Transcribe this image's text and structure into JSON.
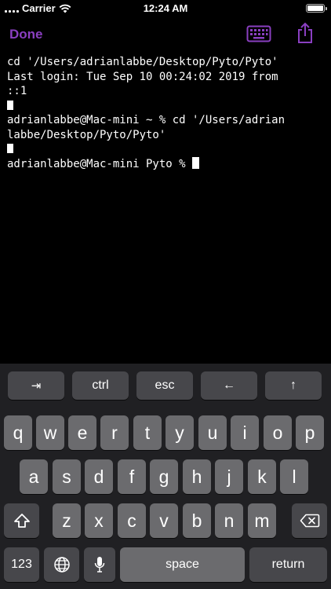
{
  "status_bar": {
    "carrier": "Carrier",
    "time": "12:24 AM"
  },
  "nav": {
    "done_label": "Done"
  },
  "terminal": {
    "lines": [
      "cd '/Users/adrianlabbe/Desktop/Pyto/Pyto'",
      "Last login: Tue Sep 10 00:24:02 2019 from",
      "::1",
      "",
      "adrianlabbe@Mac-mini ~ % cd '/Users/adrian",
      "labbe/Desktop/Pyto/Pyto'",
      "",
      "adrianlabbe@Mac-mini Pyto % "
    ]
  },
  "toolbar": {
    "tab_label": "⇥",
    "ctrl_label": "ctrl",
    "esc_label": "esc",
    "left_label": "←",
    "up_label": "↑"
  },
  "keyboard": {
    "row1": [
      "q",
      "w",
      "e",
      "r",
      "t",
      "y",
      "u",
      "i",
      "o",
      "p"
    ],
    "row2": [
      "a",
      "s",
      "d",
      "f",
      "g",
      "h",
      "j",
      "k",
      "l"
    ],
    "row3": [
      "z",
      "x",
      "c",
      "v",
      "b",
      "n",
      "m"
    ],
    "numbers_label": "123",
    "space_label": "space",
    "return_label": "return"
  },
  "colors": {
    "accent": "#8a3fc1",
    "key": "#6b6b6e",
    "special_key": "#47474b",
    "keyboard_bg": "#202023"
  },
  "icons": [
    "signal-dots-icon",
    "wifi-icon",
    "battery-icon",
    "keyboard-icon",
    "share-icon",
    "shift-icon",
    "backspace-icon",
    "globe-icon",
    "microphone-icon"
  ]
}
